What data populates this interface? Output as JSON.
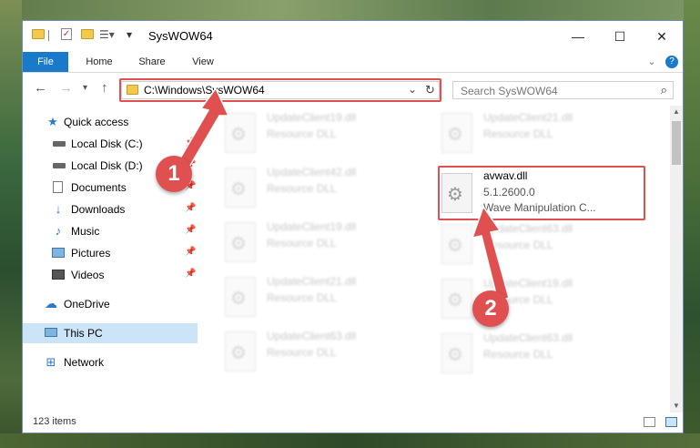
{
  "window": {
    "title": "SysWOW64"
  },
  "ribbon": {
    "tabs": [
      "File",
      "Home",
      "Share",
      "View"
    ]
  },
  "address": {
    "path": "C:\\Windows\\SysWOW64"
  },
  "search": {
    "placeholder": "Search SysWOW64"
  },
  "sidebar": {
    "items": [
      {
        "label": "Quick access",
        "icon": "star-icon"
      },
      {
        "label": "Local Disk (C:)",
        "icon": "drive-icon"
      },
      {
        "label": "Local Disk (D:)",
        "icon": "drive-icon"
      },
      {
        "label": "Documents",
        "icon": "documents-icon"
      },
      {
        "label": "Downloads",
        "icon": "download-icon"
      },
      {
        "label": "Music",
        "icon": "music-icon"
      },
      {
        "label": "Pictures",
        "icon": "pictures-icon"
      },
      {
        "label": "Videos",
        "icon": "videos-icon"
      },
      {
        "label": "OneDrive",
        "icon": "cloud-icon"
      },
      {
        "label": "This PC",
        "icon": "computer-icon"
      },
      {
        "label": "Network",
        "icon": "network-icon"
      }
    ]
  },
  "files": [
    {
      "name": "UpdateClient19.dll",
      "desc": "Resource DLL"
    },
    {
      "name": "UpdateClient21.dll",
      "desc": "Resource DLL"
    },
    {
      "name": "UpdateClient42.dll",
      "desc": "Resource DLL"
    },
    {
      "name": "avwav.dll",
      "version": "5.1.2600.0",
      "desc": "Wave Manipulation C..."
    },
    {
      "name": "UpdateClient19.dll",
      "desc": "Resource DLL"
    },
    {
      "name": "UpdateClient63.dll",
      "desc": "Resource DLL"
    },
    {
      "name": "UpdateClient21.dll",
      "desc": "Resource DLL"
    },
    {
      "name": "UpdateClient19.dll",
      "desc": "Resource DLL"
    },
    {
      "name": "UpdateClient63.dll",
      "desc": "Resource DLL"
    },
    {
      "name": "UpdateClient63.dll",
      "desc": "Resource DLL"
    }
  ],
  "status": {
    "item_count": "123 items"
  },
  "annotations": {
    "step1": "1",
    "step2": "2",
    "color": "#e05050"
  }
}
